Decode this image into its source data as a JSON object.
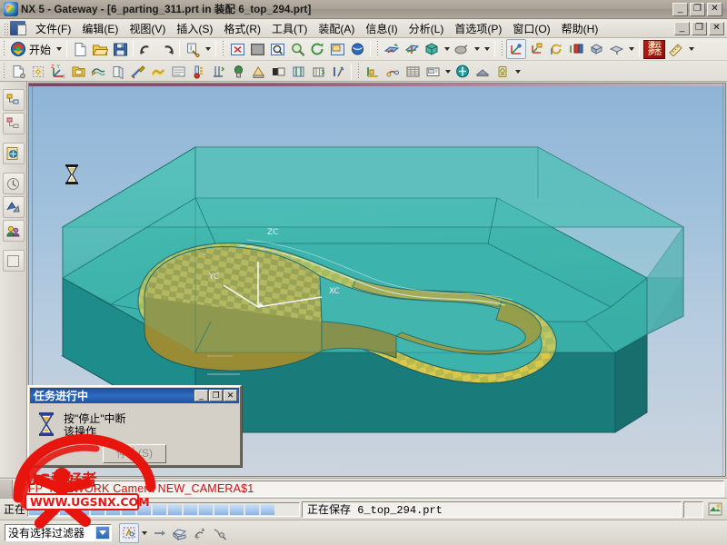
{
  "window": {
    "title": "NX 5 - Gateway - [6_parting_311.prt in 装配 6_top_294.prt]",
    "app_icon": "nx-logo-icon",
    "controls": {
      "minimize": "_",
      "restore": "❐",
      "close": "✕"
    },
    "doc_controls": {
      "minimize": "_",
      "restore": "❐",
      "close": "✕"
    }
  },
  "menubar": {
    "items": [
      {
        "label": "文件(F)",
        "name": "menu-file"
      },
      {
        "label": "编辑(E)",
        "name": "menu-edit"
      },
      {
        "label": "视图(V)",
        "name": "menu-view"
      },
      {
        "label": "插入(S)",
        "name": "menu-insert"
      },
      {
        "label": "格式(R)",
        "name": "menu-format"
      },
      {
        "label": "工具(T)",
        "name": "menu-tools"
      },
      {
        "label": "装配(A)",
        "name": "menu-assemblies"
      },
      {
        "label": "信息(I)",
        "name": "menu-information"
      },
      {
        "label": "分析(L)",
        "name": "menu-analysis"
      },
      {
        "label": "首选项(P)",
        "name": "menu-preferences"
      },
      {
        "label": "窗口(O)",
        "name": "menu-window"
      },
      {
        "label": "帮助(H)",
        "name": "menu-help"
      }
    ]
  },
  "toolbar": {
    "start_label": "开始",
    "row1": [
      "start-menu-button",
      "new-file-icon",
      "open-file-icon",
      "save-icon",
      "undo-icon",
      "redo-icon",
      "info-object-icon",
      "fit-view-icon",
      "shaded-view-icon",
      "zoom-window-icon",
      "zoom-icon",
      "rotate-icon",
      "pan-icon",
      "render-style-icon",
      "datum-plane-icon",
      "datum-axis-icon",
      "solid-body-icon",
      "shading-icon",
      "wcs-dynamics-icon",
      "wcs-origin-icon",
      "wcs-rotate-icon",
      "wcs-orient-icon",
      "wcs-display-icon",
      "wcs-save-icon",
      "stamp-icon",
      "measure-icon"
    ],
    "row2": [
      "new-part-icon",
      "wave-link-icon",
      "datum-csys-icon",
      "folder-part-icon",
      "sketch-icon",
      "extrude-icon",
      "tool-icon",
      "mold-wizard-icon",
      "form-icon",
      "thermometer-icon",
      "ejector-icon",
      "cooling-icon",
      "electrode-icon",
      "slide-lifter-icon",
      "standard-part-icon",
      "pocket-icon",
      "trim-icon",
      "layout-icon",
      "runner-icon",
      "gate-icon",
      "bom-icon",
      "drawing-icon",
      "concept-icon",
      "validate-icon",
      "mw-extra-icon"
    ]
  },
  "resource_bar": {
    "items": [
      {
        "name": "assembly-navigator-icon"
      },
      {
        "name": "part-navigator-icon"
      },
      {
        "name": "web-browser-icon"
      },
      {
        "name": "history-palette-icon"
      },
      {
        "name": "reuse-library-icon"
      },
      {
        "name": "roles-icon"
      },
      {
        "name": "blank-panel-icon"
      }
    ]
  },
  "viewport": {
    "wcs": {
      "z_label": "ZC",
      "y_label": "YC",
      "x_label": "XC"
    },
    "cursor": "hourglass-cursor",
    "model_name": "mold-parting-core-cavity"
  },
  "dialog": {
    "title": "任务进行中",
    "message_line1": "按\"停止\"中断",
    "message_line2": "该操作",
    "stop_button": "停止(S)",
    "icon": "hourglass-icon",
    "controls": {
      "minimize": "_",
      "restore": "❐",
      "close": "✕"
    }
  },
  "cue_bar": {
    "text": "TFP_IS02WORK Camera NEW_CAMERA$1",
    "color": "#d01010"
  },
  "status_bar": {
    "left_label": "正在",
    "progress_segments": 16,
    "progress_color": "#8ab4e4",
    "right_text": "正在保存 6_top_294.prt",
    "trailing_icon": "nx-status-icon"
  },
  "bottom_bar": {
    "filter_value": "没有选择过滤器",
    "items": [
      "selection-scope-icon",
      "general-select-icon",
      "snap-point-icon",
      "face-select-icon",
      "curve-select-icon",
      "feature-select-icon"
    ]
  },
  "watermark": {
    "site": "WWW.UGSNX.COM",
    "overlay_text": "UG爱好者",
    "color": "#e8150f"
  }
}
